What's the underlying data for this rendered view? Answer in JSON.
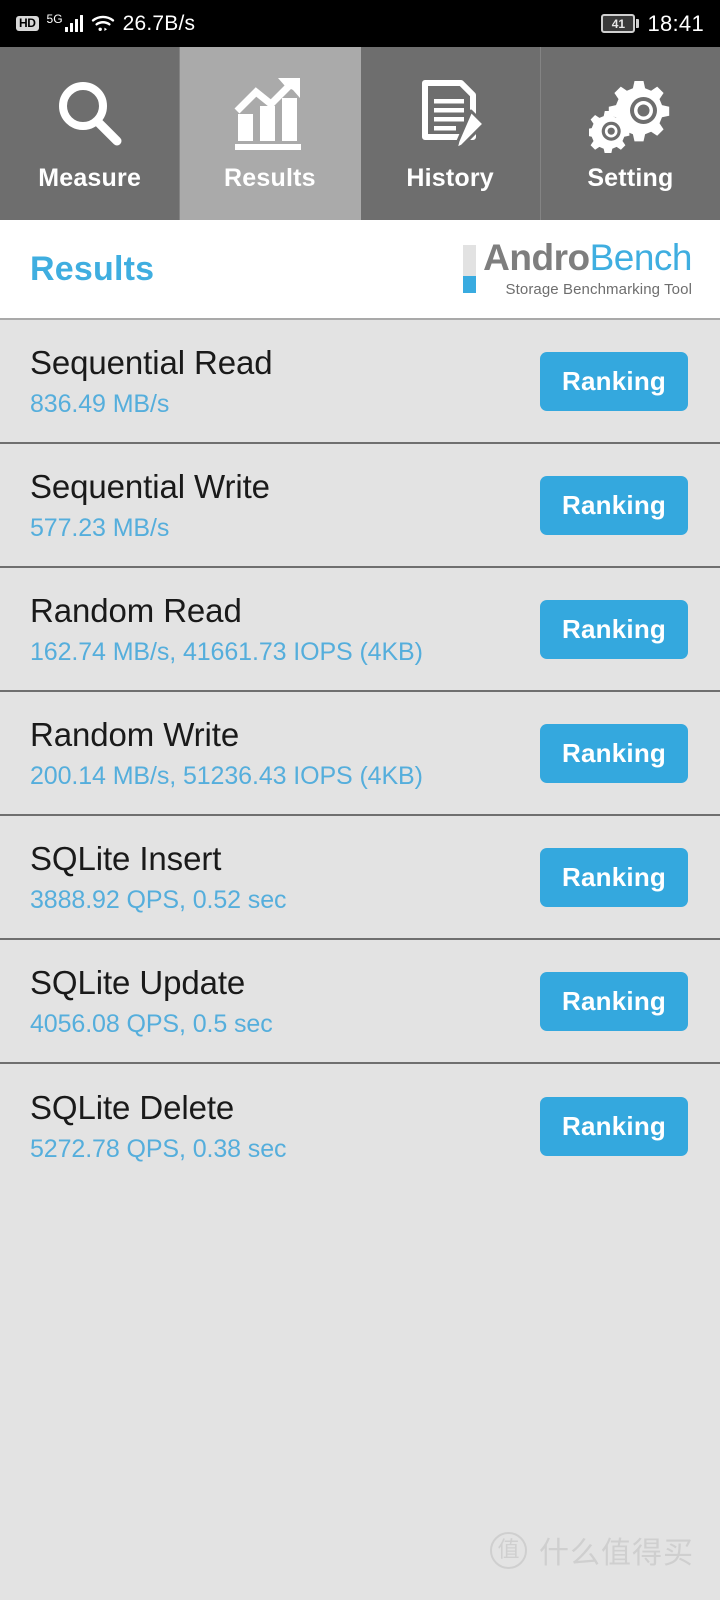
{
  "statusbar": {
    "hd_badge": "HD",
    "network_label": "5G",
    "speed": "26.7B/s",
    "battery_level": "41",
    "time": "18:41",
    "icons": [
      "hd-icon",
      "signal-bars-icon",
      "wifi-icon",
      "battery-icon"
    ]
  },
  "tabs": [
    {
      "label": "Measure",
      "icon": "magnifier-icon",
      "active": false
    },
    {
      "label": "Results",
      "icon": "bar-chart-icon",
      "active": true
    },
    {
      "label": "History",
      "icon": "document-pencil-icon",
      "active": false
    },
    {
      "label": "Setting",
      "icon": "gears-icon",
      "active": false
    }
  ],
  "header": {
    "title": "Results",
    "logo_andro": "Andro",
    "logo_bench": "Bench",
    "logo_subtitle": "Storage Benchmarking Tool"
  },
  "colors": {
    "accent_blue": "#34A8DE",
    "value_blue": "#55AEDC",
    "title_blue": "#3FAEE0",
    "tab_bg": "#6E6E6E",
    "tab_active_bg": "#AAAAAA",
    "list_bg": "#E3E3E3"
  },
  "results": [
    {
      "name": "Sequential Read",
      "value": "836.49 MB/s",
      "button": "Ranking"
    },
    {
      "name": "Sequential Write",
      "value": "577.23 MB/s",
      "button": "Ranking"
    },
    {
      "name": "Random Read",
      "value": "162.74 MB/s, 41661.73 IOPS (4KB)",
      "button": "Ranking"
    },
    {
      "name": "Random Write",
      "value": "200.14 MB/s, 51236.43 IOPS (4KB)",
      "button": "Ranking"
    },
    {
      "name": "SQLite Insert",
      "value": "3888.92 QPS, 0.52 sec",
      "button": "Ranking"
    },
    {
      "name": "SQLite Update",
      "value": "4056.08 QPS, 0.5 sec",
      "button": "Ranking"
    },
    {
      "name": "SQLite Delete",
      "value": "5272.78 QPS, 0.38 sec",
      "button": "Ranking"
    }
  ],
  "watermark": {
    "mark": "值",
    "text": "什么值得买"
  }
}
